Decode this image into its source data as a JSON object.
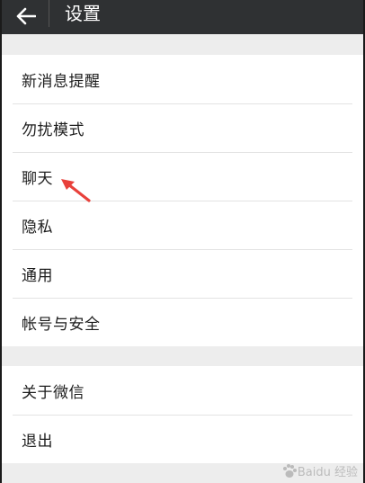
{
  "header": {
    "back_icon": "arrow-left-icon",
    "title": "设置"
  },
  "settings_group_1": [
    {
      "label": "新消息提醒"
    },
    {
      "label": "勿扰模式"
    },
    {
      "label": "聊天"
    },
    {
      "label": "隐私"
    },
    {
      "label": "通用"
    },
    {
      "label": "帐号与安全"
    }
  ],
  "settings_group_2": [
    {
      "label": "关于微信"
    },
    {
      "label": "退出"
    }
  ],
  "annotation": {
    "arrow_color": "#e8413b"
  },
  "watermark": {
    "text": "Baidu 经验"
  },
  "colors": {
    "topbar": "#2f3133",
    "background": "#ededed",
    "row": "#ffffff",
    "text": "#1d1d1d"
  }
}
